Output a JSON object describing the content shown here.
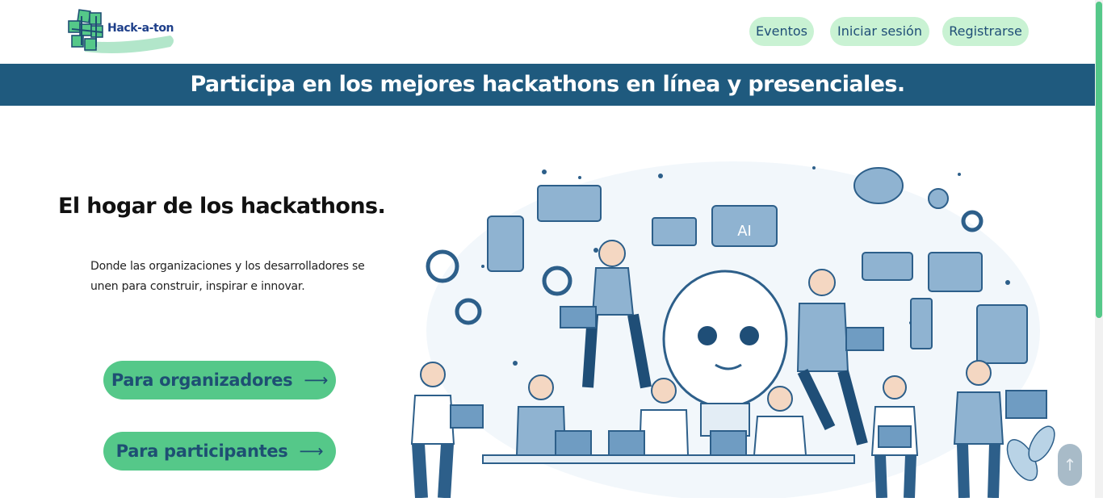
{
  "brand": {
    "name": "Hack-a-ton",
    "logo_color": "#55c889"
  },
  "nav": {
    "items": [
      {
        "label": "Eventos"
      },
      {
        "label": "Iniciar sesión"
      },
      {
        "label": "Registrarse"
      }
    ]
  },
  "banner": {
    "text": "Participa en los mejores hackathons en línea y presenciales."
  },
  "hero": {
    "title": "El hogar de los hackathons.",
    "description": "Donde las organizaciones y los desarrolladores se unen para construir, inspirar e innovar.",
    "buttons": [
      {
        "label": "Para organizadores",
        "icon": "arrow-right-icon"
      },
      {
        "label": "Para participantes",
        "icon": "arrow-right-icon"
      }
    ]
  },
  "scroll_top": {
    "icon": "arrow-up-icon"
  },
  "colors": {
    "accent": "#55c889",
    "nav_button_bg": "#c9f2d3",
    "banner_bg": "#1f5a7e",
    "text_dark": "#1e4f73"
  }
}
